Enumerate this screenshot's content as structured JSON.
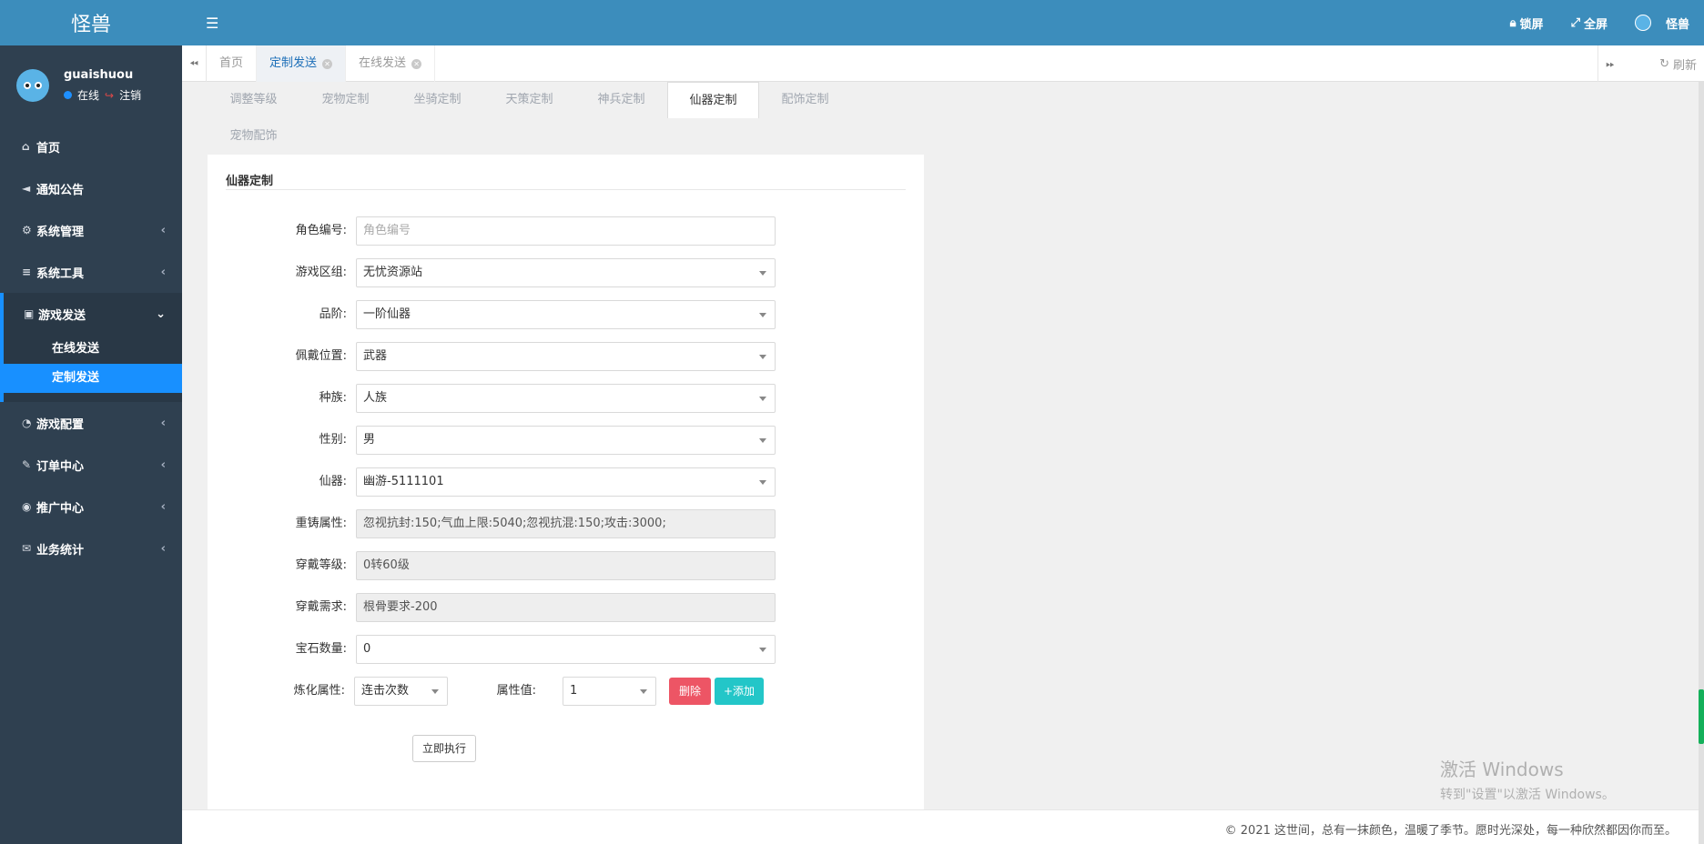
{
  "app": {
    "title": "怪兽"
  },
  "user": {
    "name": "guaishuou",
    "status": "在线",
    "logout": "注销"
  },
  "sidebar": {
    "items": [
      {
        "label": "首页",
        "icon": "home-icon"
      },
      {
        "label": "通知公告",
        "icon": "bullhorn-icon"
      },
      {
        "label": "系统管理",
        "icon": "gear-icon"
      },
      {
        "label": "系统工具",
        "icon": "bars-icon"
      },
      {
        "label": "游戏发送",
        "icon": "gift-icon"
      },
      {
        "label": "游戏配置",
        "icon": "dashboard-icon"
      },
      {
        "label": "订单中心",
        "icon": "brush-icon"
      },
      {
        "label": "推广中心",
        "icon": "eye-icon"
      },
      {
        "label": "业务统计",
        "icon": "envelope-icon"
      }
    ],
    "sub_items": [
      {
        "label": "在线发送"
      },
      {
        "label": "定制发送"
      }
    ]
  },
  "header": {
    "lock": "锁屏",
    "fullscreen": "全屏",
    "username": "怪兽"
  },
  "tabs": {
    "items": [
      {
        "label": "首页"
      },
      {
        "label": "定制发送"
      },
      {
        "label": "在线发送"
      }
    ],
    "refresh": "刷新"
  },
  "subtabs": {
    "items": [
      "调整等级",
      "宠物定制",
      "坐骑定制",
      "天策定制",
      "神兵定制",
      "仙器定制",
      "配饰定制"
    ],
    "row2": [
      "宠物配饰"
    ]
  },
  "form": {
    "title": "仙器定制",
    "role_id": {
      "label": "角色编号:",
      "placeholder": "角色编号"
    },
    "server": {
      "label": "游戏区组:",
      "value": "无忧资源站"
    },
    "grade": {
      "label": "品阶:",
      "value": "一阶仙器"
    },
    "slot": {
      "label": "佩戴位置:",
      "value": "武器"
    },
    "race": {
      "label": "种族:",
      "value": "人族"
    },
    "gender": {
      "label": "性别:",
      "value": "男"
    },
    "artifact": {
      "label": "仙器:",
      "value": "幽游-5111101"
    },
    "recast": {
      "label": "重铸属性:",
      "value": "忽视抗封:150;气血上限:5040;忽视抗混:150;攻击:3000;"
    },
    "wear_level": {
      "label": "穿戴等级:",
      "value": "0转60级"
    },
    "wear_req": {
      "label": "穿戴需求:",
      "value": "根骨要求-200"
    },
    "gems": {
      "label": "宝石数量:",
      "value": "0"
    },
    "refine": {
      "label": "炼化属性:",
      "attr": "连击次数",
      "value_label": "属性值:",
      "value": "1",
      "delete": "删除",
      "add": "+添加"
    },
    "execute": "立即执行"
  },
  "footer": {
    "text": "© 2021 这世间，总有一抹颜色，温暖了季节。愿时光深处，每一种欣然都因你而至。"
  },
  "watermark": {
    "line1": "激活 Windows",
    "line2": "转到\"设置\"以激活 Windows。"
  }
}
